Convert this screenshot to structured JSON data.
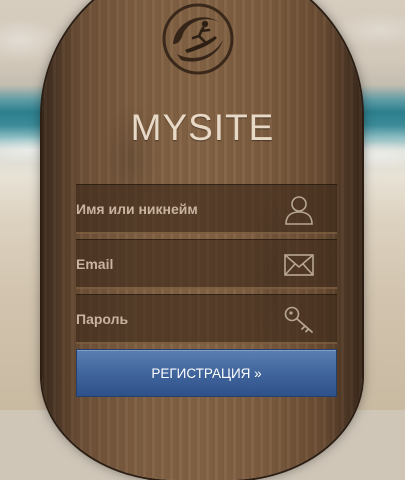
{
  "site": {
    "title": "MYSITE"
  },
  "form": {
    "fields": [
      {
        "label": "Имя или никнейм",
        "icon": "user-icon"
      },
      {
        "label": "Email",
        "icon": "envelope-icon"
      },
      {
        "label": "Пароль",
        "icon": "key-icon"
      }
    ],
    "submit_label": "РЕГИСТРАЦИЯ »"
  },
  "colors": {
    "button": "#3e639a",
    "title": "#e7d9c6",
    "field_label": "#c8b4a0"
  }
}
